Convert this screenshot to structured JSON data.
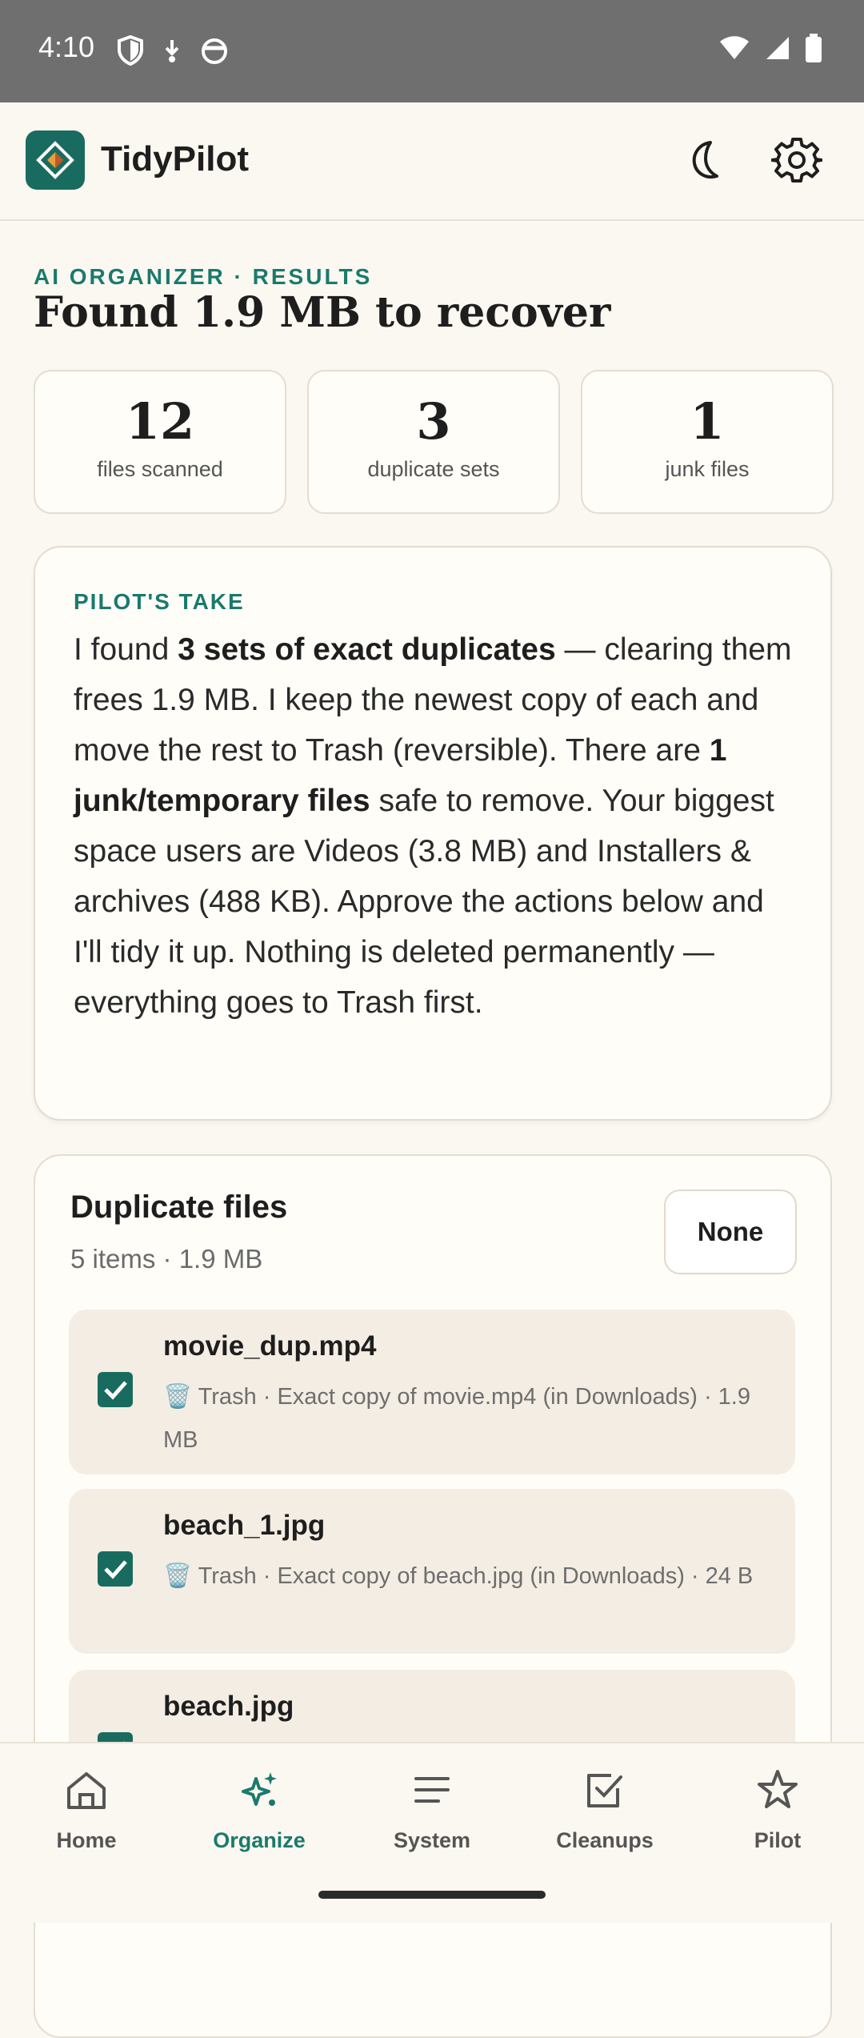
{
  "status": {
    "time": "4:10"
  },
  "app": {
    "title": "TidyPilot"
  },
  "main": {
    "eyebrow": "AI ORGANIZER · RESULTS",
    "headline": "Found 1.9 MB to recover",
    "stats": [
      {
        "value": "12",
        "label": "files scanned"
      },
      {
        "value": "3",
        "label": "duplicate sets"
      },
      {
        "value": "1",
        "label": "junk files"
      }
    ]
  },
  "take": {
    "label": "PILOT'S TAKE",
    "t1": "I found ",
    "b1": "3 sets of exact duplicates",
    "t2": " — clearing them frees 1.9 MB. I keep the newest copy of each and move the rest to Trash (reversible). There are ",
    "b2": "1 junk/temporary files",
    "t3": " safe to remove. Your biggest space users are Videos (3.8 MB) and Installers & archives (488 KB). Approve the actions below and I'll tidy it up. Nothing is deleted permanently — everything goes to Trash first."
  },
  "duplicates": {
    "title": "Duplicate files",
    "meta": "5 items · 1.9 MB",
    "none_label": "None",
    "items": [
      {
        "name": "movie_dup.mp4",
        "detail": "🗑️ Trash · Exact copy of movie.mp4 (in Downloads) · 1.9 MB"
      },
      {
        "name": "beach_1.jpg",
        "detail": "🗑️ Trash · Exact copy of beach.jpg (in Downloads) · 24 B"
      },
      {
        "name": "beach.jpg",
        "detail": ""
      }
    ]
  },
  "nav": {
    "items": [
      {
        "label": "Home",
        "icon": "home-icon"
      },
      {
        "label": "Organize",
        "icon": "sparkle-icon"
      },
      {
        "label": "System",
        "icon": "menu-icon"
      },
      {
        "label": "Cleanups",
        "icon": "checkbox-icon"
      },
      {
        "label": "Pilot",
        "icon": "star-icon"
      }
    ],
    "active": "Organize"
  },
  "colors": {
    "accent": "#1a6b5f",
    "accent_text": "#1a7a6c",
    "background": "#fbf8f1",
    "status_bar": "#6f6f6f"
  }
}
